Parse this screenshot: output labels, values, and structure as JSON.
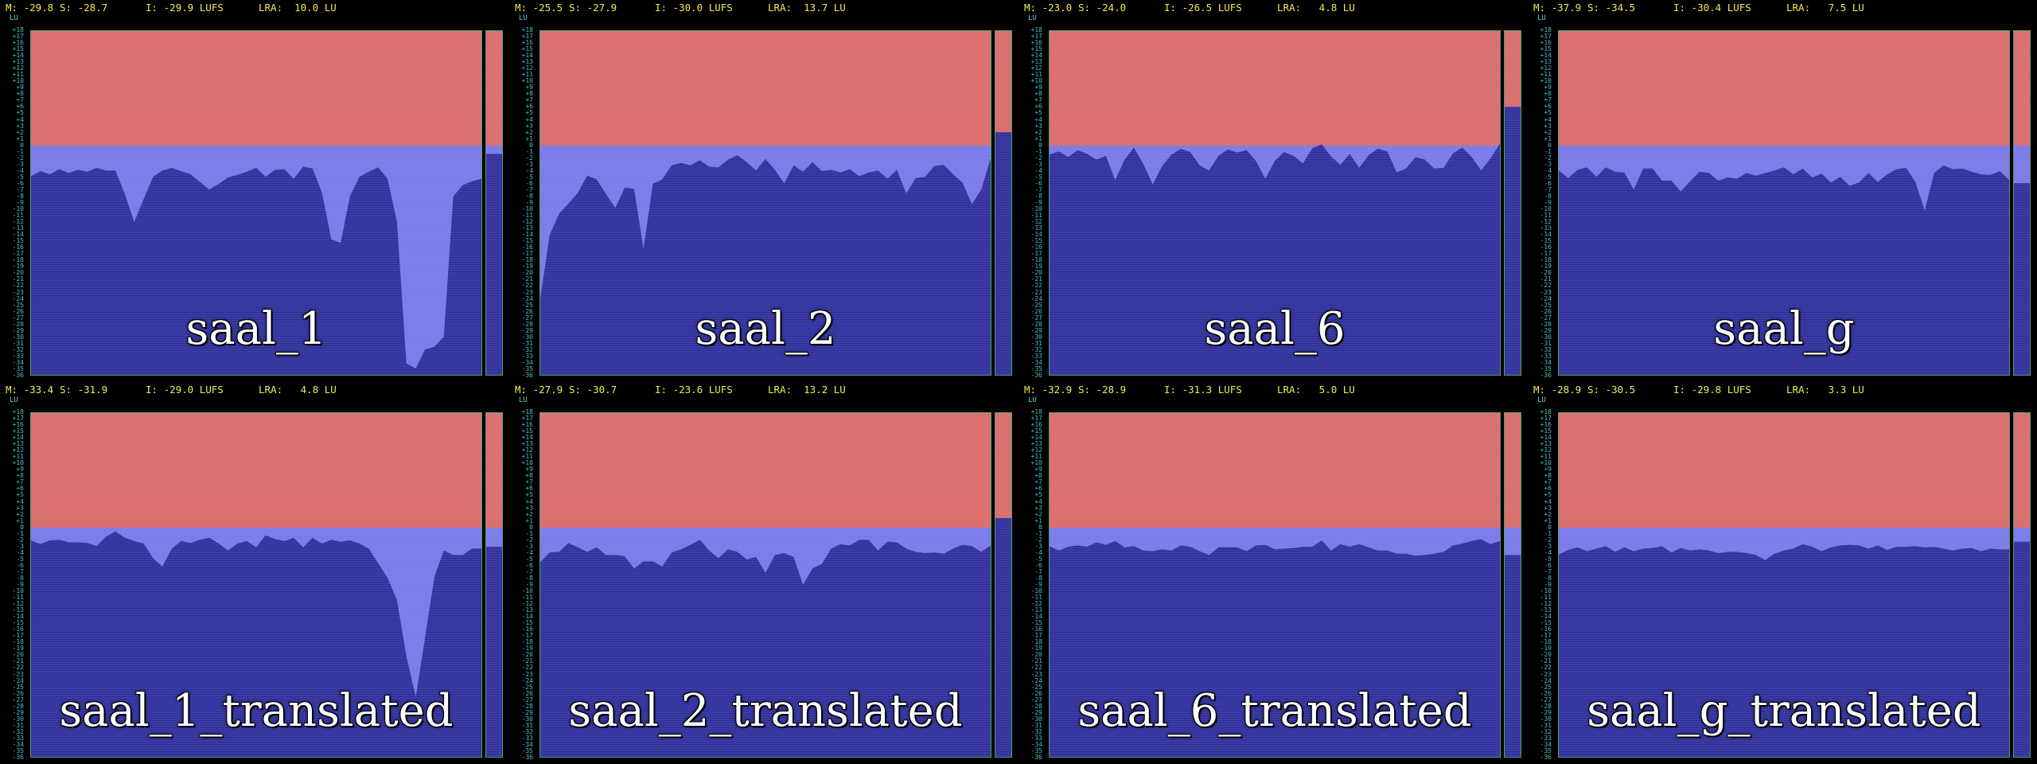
{
  "window": {
    "background": "#000000"
  },
  "colors": {
    "target_zone": "#d96a6a",
    "loud_zone": "#7878e8",
    "fill": "#2e2e9c",
    "border": "#4fa070",
    "stats_text": "#ecec52",
    "scale_text": "#49c0c8",
    "label_text": "#ffffff"
  },
  "scale": {
    "unit": "LU",
    "ticks": [
      "+18",
      "+17",
      "+16",
      "+15",
      "+14",
      "+13",
      "+12",
      "+11",
      "+10",
      "+9",
      "+8",
      "+7",
      "+6",
      "+5",
      "+4",
      "+3",
      "+2",
      "+1",
      "0",
      "-1",
      "-2",
      "-3",
      "-4",
      "-5",
      "-6",
      "-7",
      "-8",
      "-9",
      "-10",
      "-11",
      "-12",
      "-13",
      "-14",
      "-15",
      "-16",
      "-17",
      "-18",
      "-19",
      "-20",
      "-21",
      "-22",
      "-23",
      "-24",
      "-25",
      "-26",
      "-27",
      "-28",
      "-29",
      "-30",
      "-31",
      "-32",
      "-33",
      "-34",
      "-35",
      "-36"
    ]
  },
  "panels": [
    {
      "label": "saal_1",
      "momentary": "M: -29.8",
      "short_term": "S: -28.7",
      "integrated": "I: -29.9 LUFS",
      "lra": "LRA:  10.0 LU",
      "short_term_level_lu": -1.3,
      "history": [
        -4.8,
        -4.0,
        -4.5,
        -3.7,
        -4.3,
        -3.8,
        -4.1,
        -3.5,
        -3.9,
        -3.9,
        -7.6,
        -12.0,
        -8.4,
        -4.9,
        -3.9,
        -3.5,
        -4.0,
        -4.5,
        -5.7,
        -6.9,
        -6.0,
        -5.0,
        -4.6,
        -4.1,
        -3.5,
        -4.9,
        -3.8,
        -3.7,
        -5.2,
        -3.3,
        -3.6,
        -7.3,
        -14.7,
        -15.3,
        -7.9,
        -4.9,
        -4.1,
        -3.4,
        -5.2,
        -12.0,
        -34.2,
        -35.0,
        -32.0,
        -31.6,
        -30.0,
        -8.0,
        -6.2,
        -5.6,
        -5.2
      ]
    },
    {
      "label": "saal_2",
      "momentary": "M: -25.5",
      "short_term": "S: -27.9",
      "integrated": "I: -30.0 LUFS",
      "lra": "LRA:  13.7 LU",
      "short_term_level_lu": 2.1,
      "history": [
        -24.0,
        -14.0,
        -10.7,
        -9.1,
        -7.4,
        -4.7,
        -5.3,
        -7.6,
        -9.8,
        -6.6,
        -6.8,
        -16.2,
        -6.0,
        -5.3,
        -3.1,
        -2.7,
        -3.1,
        -2.3,
        -3.3,
        -3.4,
        -2.2,
        -1.5,
        -2.6,
        -3.9,
        -2.1,
        -3.8,
        -5.9,
        -3.1,
        -4.1,
        -2.6,
        -4.0,
        -3.8,
        -4.2,
        -3.7,
        -4.8,
        -4.2,
        -3.9,
        -5.2,
        -3.8,
        -7.5,
        -5.1,
        -4.9,
        -3.2,
        -3.0,
        -4.5,
        -5.8,
        -9.2,
        -6.9,
        -2.0
      ]
    },
    {
      "label": "saal_6",
      "momentary": "M: -23.0",
      "short_term": "S: -24.0",
      "integrated": "I: -26.5 LUFS",
      "lra": "LRA:   4.8 LU",
      "short_term_level_lu": 6.1,
      "history": [
        -1.4,
        -0.9,
        -1.8,
        -0.7,
        -1.3,
        -2.2,
        -1.6,
        -5.4,
        -2.2,
        -0.3,
        -2.9,
        -6.1,
        -3.2,
        -1.4,
        -0.5,
        -1.0,
        -3.1,
        -3.9,
        -1.6,
        -0.6,
        -1.1,
        -0.7,
        -2.4,
        -5.2,
        -2.4,
        -1.0,
        -1.6,
        -2.8,
        -0.4,
        0.2,
        -1.7,
        -3.0,
        -1.3,
        -3.5,
        -1.5,
        -0.5,
        -0.9,
        -4.2,
        -3.6,
        -1.8,
        -2.2,
        -3.6,
        -3.5,
        -1.2,
        -0.3,
        -1.8,
        -3.9,
        -2.0,
        0.3
      ]
    },
    {
      "label": "saal_g",
      "momentary": "M: -37.9",
      "short_term": "S: -34.5",
      "integrated": "I: -30.4 LUFS",
      "lra": "LRA:   7.5 LU",
      "short_term_level_lu": -5.9,
      "history": [
        -3.9,
        -5.1,
        -3.8,
        -3.4,
        -4.9,
        -3.4,
        -4.1,
        -4.2,
        -6.9,
        -3.6,
        -3.6,
        -5.5,
        -5.5,
        -7.2,
        -5.6,
        -4.1,
        -4.3,
        -5.5,
        -5.0,
        -5.2,
        -4.3,
        -4.7,
        -4.3,
        -3.9,
        -3.4,
        -4.5,
        -3.6,
        -5.0,
        -4.4,
        -5.8,
        -4.9,
        -6.3,
        -5.8,
        -4.3,
        -5.7,
        -4.5,
        -3.7,
        -3.5,
        -5.7,
        -10.2,
        -4.3,
        -3.1,
        -3.7,
        -3.6,
        -4.1,
        -4.5,
        -4.6,
        -4.0,
        -5.4
      ]
    },
    {
      "label": "saal_1_translated",
      "momentary": "M: -33.4",
      "short_term": "S: -31.9",
      "integrated": "I: -29.0 LUFS",
      "lra": "LRA:   4.8 LU",
      "short_term_level_lu": -3.0,
      "history": [
        -2.0,
        -2.6,
        -2.0,
        -1.9,
        -2.3,
        -2.3,
        -2.4,
        -2.9,
        -1.4,
        -0.6,
        -1.6,
        -2.1,
        -2.5,
        -4.8,
        -6.1,
        -3.3,
        -2.1,
        -2.4,
        -1.9,
        -1.6,
        -2.5,
        -3.6,
        -2.5,
        -2.1,
        -3.1,
        -1.2,
        -1.8,
        -2.1,
        -1.6,
        -3.1,
        -1.6,
        -2.5,
        -1.9,
        -2.2,
        -2.0,
        -2.5,
        -3.3,
        -5.6,
        -7.9,
        -11.4,
        -20.2,
        -26.6,
        -17.2,
        -7.7,
        -3.6,
        -4.3,
        -4.3,
        -3.3,
        -3.3
      ]
    },
    {
      "label": "saal_2_translated",
      "momentary": "M: -27.9",
      "short_term": "S: -30.7",
      "integrated": "I: -23.6 LUFS",
      "lra": "LRA:  13.2 LU",
      "short_term_level_lu": 1.5,
      "history": [
        -5.4,
        -3.9,
        -3.8,
        -2.4,
        -3.1,
        -3.8,
        -3.1,
        -4.3,
        -4.3,
        -4.5,
        -6.4,
        -5.3,
        -5.3,
        -6.1,
        -3.9,
        -3.4,
        -2.7,
        -1.9,
        -3.6,
        -4.8,
        -3.4,
        -3.8,
        -5.0,
        -4.6,
        -7.1,
        -4.3,
        -4.0,
        -4.6,
        -9.0,
        -6.4,
        -5.7,
        -3.3,
        -2.6,
        -2.8,
        -1.9,
        -1.9,
        -3.6,
        -2.2,
        -2.3,
        -3.3,
        -3.8,
        -4.0,
        -3.9,
        -4.1,
        -3.3,
        -2.7,
        -2.9,
        -3.8,
        -2.8
      ]
    },
    {
      "label": "saal_6_translated",
      "momentary": "M: -32.9",
      "short_term": "S: -28.9",
      "integrated": "I: -31.3 LUFS",
      "lra": "LRA:   5.0 LU",
      "short_term_level_lu": -4.3,
      "history": [
        -2.9,
        -3.6,
        -3.0,
        -2.8,
        -3.0,
        -2.3,
        -2.7,
        -2.1,
        -3.1,
        -2.9,
        -3.6,
        -3.7,
        -3.4,
        -3.6,
        -2.8,
        -3.0,
        -3.7,
        -4.3,
        -3.1,
        -3.1,
        -3.1,
        -3.7,
        -2.8,
        -2.7,
        -3.4,
        -3.3,
        -3.2,
        -3.0,
        -3.0,
        -2.0,
        -3.6,
        -2.6,
        -3.0,
        -2.6,
        -3.1,
        -3.6,
        -3.6,
        -4.1,
        -4.1,
        -4.4,
        -4.3,
        -4.1,
        -3.8,
        -2.8,
        -2.5,
        -2.1,
        -1.8,
        -2.6,
        -2.1
      ]
    },
    {
      "label": "saal_g_translated",
      "momentary": "M: -28.9",
      "short_term": "S: -30.5",
      "integrated": "I: -29.8 LUFS",
      "lra": "LRA:   3.3 LU",
      "short_term_level_lu": -2.2,
      "history": [
        -4.2,
        -3.5,
        -3.1,
        -3.7,
        -3.3,
        -2.9,
        -3.8,
        -3.1,
        -3.7,
        -3.3,
        -3.2,
        -2.9,
        -3.9,
        -3.2,
        -3.6,
        -3.4,
        -3.6,
        -4.0,
        -3.8,
        -3.8,
        -4.0,
        -4.3,
        -5.1,
        -4.1,
        -3.6,
        -3.3,
        -2.6,
        -3.0,
        -3.7,
        -3.1,
        -2.8,
        -2.7,
        -2.8,
        -3.3,
        -2.8,
        -3.5,
        -3.0,
        -3.0,
        -2.9,
        -3.1,
        -3.0,
        -3.3,
        -3.6,
        -3.3,
        -3.2,
        -3.7,
        -3.3,
        -3.4,
        -3.4
      ]
    }
  ]
}
